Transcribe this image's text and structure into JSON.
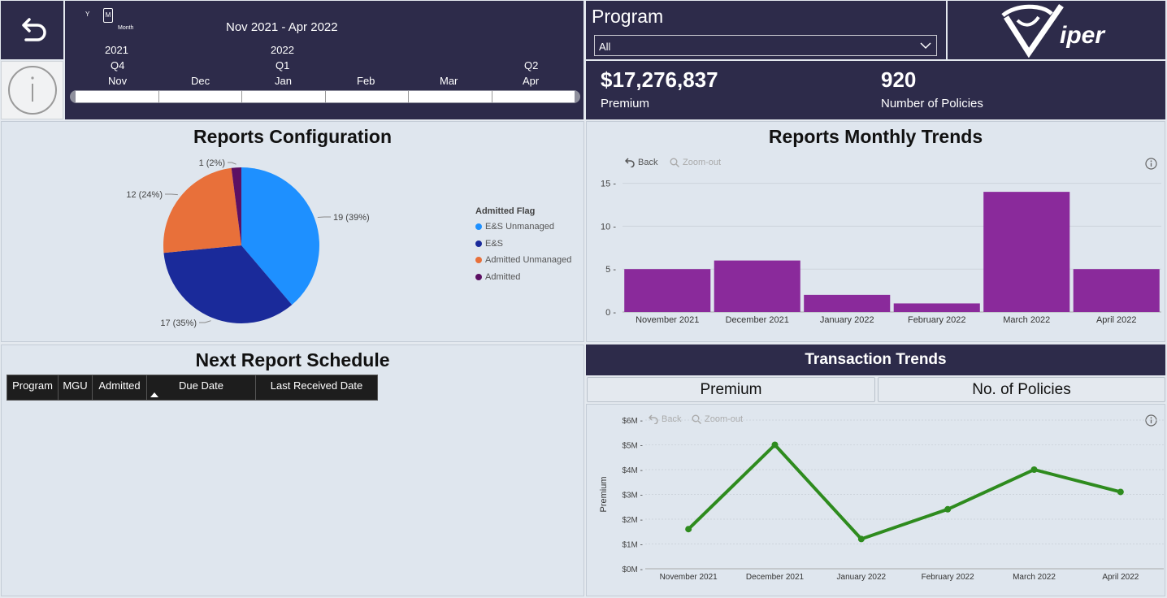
{
  "nav": {
    "back_icon": "undo-arrow-icon",
    "info_icon": "info-circle-icon"
  },
  "slicer": {
    "range_label": "Nov 2021 - Apr 2022",
    "hierarchy_y": "Y",
    "hierarchy_m": "M",
    "hierarchy_caption": "Month",
    "years": [
      "2021",
      "2022"
    ],
    "quarters": [
      "Q4",
      "Q1",
      "Q2"
    ],
    "months": [
      "Nov",
      "Dec",
      "Jan",
      "Feb",
      "Mar",
      "Apr"
    ]
  },
  "program_filter": {
    "title": "Program",
    "selected": "All"
  },
  "logo": {
    "text": "iper"
  },
  "kpis": {
    "premium_value": "$17,276,837",
    "premium_label": "Premium",
    "policies_value": "920",
    "policies_label": "Number of Policies"
  },
  "reports_config": {
    "title": "Reports Configuration",
    "legend_title": "Admitted Flag",
    "legend": [
      {
        "label": "E&S Unmanaged",
        "color": "#1e90ff"
      },
      {
        "label": "E&S",
        "color": "#1a2a9a"
      },
      {
        "label": "Admitted Unmanaged",
        "color": "#e8703a"
      },
      {
        "label": "Admitted",
        "color": "#5c1063"
      }
    ],
    "slice_labels": [
      "19 (39%)",
      "17 (35%)",
      "12 (24%)",
      "1 (2%)"
    ]
  },
  "monthly_trends": {
    "title": "Reports Monthly Trends",
    "back_label": "Back",
    "zoom_label": "Zoom-out"
  },
  "schedule": {
    "title": "Next Report Schedule",
    "columns": [
      "Program",
      "MGU",
      "Admitted",
      "Due Date",
      "Last Received Date"
    ]
  },
  "transaction": {
    "title": "Transaction Trends",
    "tab_premium": "Premium",
    "tab_policies": "No. of Policies",
    "back_label": "Back",
    "zoom_label": "Zoom-out"
  },
  "chart_data": [
    {
      "type": "pie",
      "title": "Reports Configuration",
      "legend_title": "Admitted Flag",
      "categories": [
        "E&S Unmanaged",
        "E&S",
        "Admitted Unmanaged",
        "Admitted"
      ],
      "values": [
        19,
        17,
        12,
        1
      ],
      "colors": [
        "#1e90ff",
        "#1a2a9a",
        "#e8703a",
        "#5c1063"
      ]
    },
    {
      "type": "bar",
      "title": "Reports Monthly Trends",
      "categories": [
        "November 2021",
        "December 2021",
        "January 2022",
        "February 2022",
        "March 2022",
        "April 2022"
      ],
      "values": [
        5,
        6,
        2,
        1,
        14,
        5
      ],
      "yticks": [
        "0",
        "5",
        "10",
        "15"
      ],
      "ylim": [
        0,
        16
      ],
      "color": "#8a2a9b"
    },
    {
      "type": "line",
      "title": "Transaction Trends",
      "ylabel": "Premium",
      "categories": [
        "November 2021",
        "December 2021",
        "January 2022",
        "February 2022",
        "March 2022",
        "April 2022"
      ],
      "values": [
        1.6,
        5.0,
        1.2,
        2.4,
        4.0,
        3.1
      ],
      "yticks": [
        "$0M",
        "$1M",
        "$2M",
        "$3M",
        "$4M",
        "$5M",
        "$6M"
      ],
      "ylim": [
        0,
        6
      ],
      "color": "#2e8b1e"
    }
  ]
}
